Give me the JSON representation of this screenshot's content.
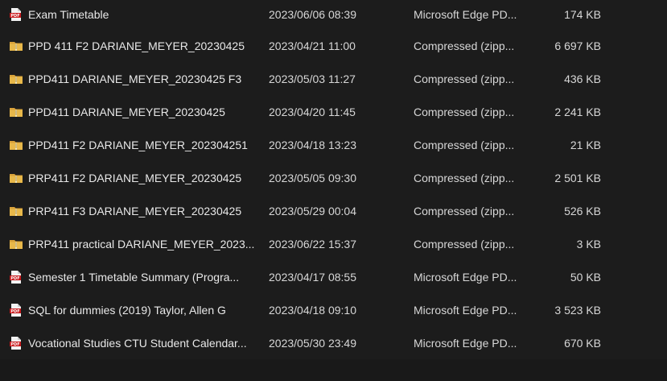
{
  "files": [
    {
      "name": "Exam Timetable",
      "date": "2023/06/06 08:39",
      "type": "Microsoft Edge PD...",
      "size": "174 KB",
      "icon": "pdf-icon"
    },
    {
      "name": "PPD 411 F2 DARIANE_MEYER_20230425",
      "date": "2023/04/21 11:00",
      "type": "Compressed (zipp...",
      "size": "6 697 KB",
      "icon": "zip-folder-icon"
    },
    {
      "name": "PPD411 DARIANE_MEYER_20230425 F3",
      "date": "2023/05/03 11:27",
      "type": "Compressed (zipp...",
      "size": "436 KB",
      "icon": "zip-folder-icon"
    },
    {
      "name": "PPD411 DARIANE_MEYER_20230425",
      "date": "2023/04/20 11:45",
      "type": "Compressed (zipp...",
      "size": "2 241 KB",
      "icon": "zip-folder-icon"
    },
    {
      "name": "PPD411 F2 DARIANE_MEYER_202304251",
      "date": "2023/04/18 13:23",
      "type": "Compressed (zipp...",
      "size": "21 KB",
      "icon": "zip-folder-icon"
    },
    {
      "name": "PRP411 F2 DARIANE_MEYER_20230425",
      "date": "2023/05/05 09:30",
      "type": "Compressed (zipp...",
      "size": "2 501 KB",
      "icon": "zip-folder-icon"
    },
    {
      "name": "PRP411 F3 DARIANE_MEYER_20230425",
      "date": "2023/05/29 00:04",
      "type": "Compressed (zipp...",
      "size": "526 KB",
      "icon": "zip-folder-icon"
    },
    {
      "name": "PRP411 practical DARIANE_MEYER_2023...",
      "date": "2023/06/22 15:37",
      "type": "Compressed (zipp...",
      "size": "3 KB",
      "icon": "zip-folder-icon"
    },
    {
      "name": "Semester 1 Timetable Summary (Progra...",
      "date": "2023/04/17 08:55",
      "type": "Microsoft Edge PD...",
      "size": "50 KB",
      "icon": "pdf-icon"
    },
    {
      "name": "SQL for dummies (2019) Taylor, Allen G",
      "date": "2023/04/18 09:10",
      "type": "Microsoft Edge PD...",
      "size": "3 523 KB",
      "icon": "pdf-icon"
    },
    {
      "name": "Vocational Studies CTU Student Calendar...",
      "date": "2023/05/30 23:49",
      "type": "Microsoft Edge PD...",
      "size": "670 KB",
      "icon": "pdf-icon"
    }
  ],
  "colors": {
    "background": "#1c1c1c",
    "text": "#e8e8e8",
    "pdf_red": "#c8191c",
    "folder_yellow": "#e8b84a"
  }
}
